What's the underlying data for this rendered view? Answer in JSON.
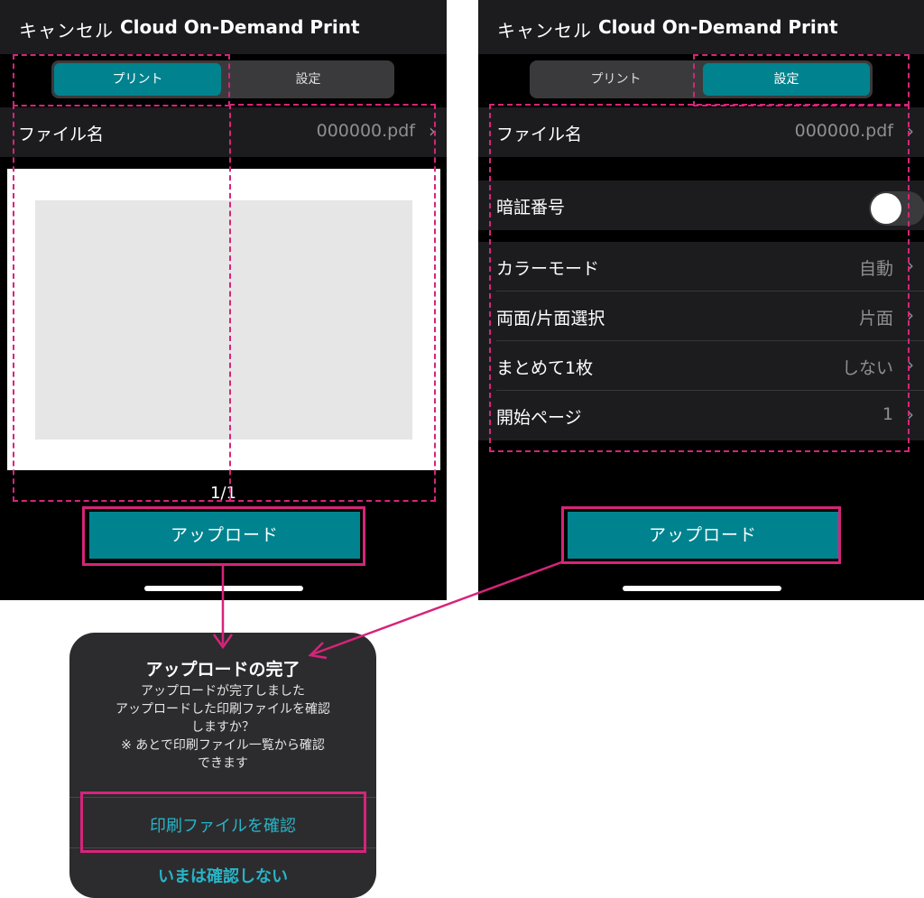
{
  "nav": {
    "cancel_label": "キャンセル",
    "title": "Cloud On-Demand Print"
  },
  "segments": {
    "print_label": "プリント",
    "settings_label": "設定"
  },
  "left_screen": {
    "file_row": {
      "label": "ファイル名",
      "value": "000000.pdf"
    },
    "page_indicator": "1/1",
    "upload_label": "アップロード"
  },
  "right_screen": {
    "file_row": {
      "label": "ファイル名",
      "value": "000000.pdf"
    },
    "pin_row": {
      "label": "暗証番号",
      "enabled": false
    },
    "settings": [
      {
        "label": "カラーモード",
        "value": "自動"
      },
      {
        "label": "両面/片面選択",
        "value": "片面"
      },
      {
        "label": "まとめて1枚",
        "value": "しない"
      },
      {
        "label": "開始ページ",
        "value": "1"
      }
    ],
    "upload_label": "アップロード"
  },
  "dialog": {
    "title": "アップロードの完了",
    "message_lines": [
      "アップロードが完了しました",
      "アップロードした印刷ファイルを確認",
      "しますか？",
      "※ あとで印刷ファイル一覧から確認",
      "できます"
    ],
    "confirm_label": "印刷ファイルを確認",
    "skip_label": "いまは確認しない"
  },
  "colors": {
    "accent": "#00838f",
    "annotation": "#d6247a",
    "link": "#27b5c8",
    "background": "#000000"
  },
  "icons": {
    "chevron": "chevron-right-icon",
    "toggle": "toggle-switch"
  }
}
